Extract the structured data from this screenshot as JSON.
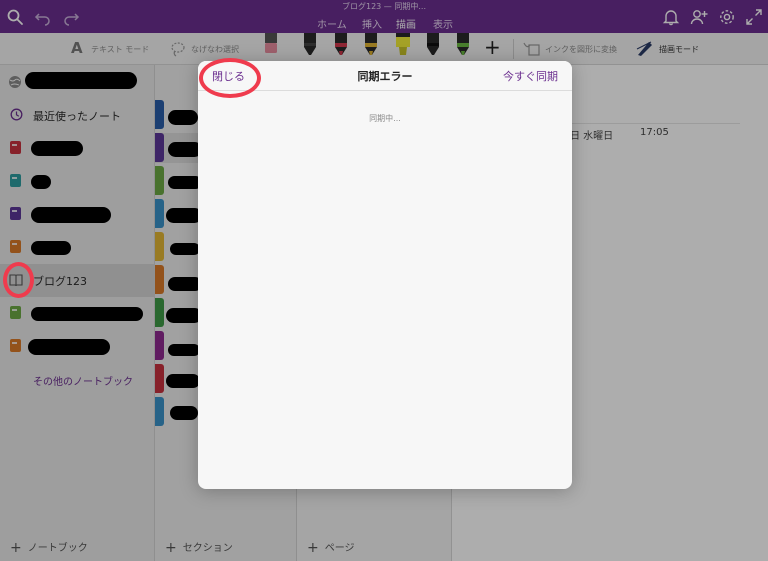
{
  "window": {
    "document_title": "ブログ123 — 同期中..."
  },
  "tabs": [
    {
      "label": "ホーム",
      "active": false
    },
    {
      "label": "挿入",
      "active": false
    },
    {
      "label": "描画",
      "active": true
    },
    {
      "label": "表示",
      "active": false
    }
  ],
  "ribbon": {
    "text_mode": "テキスト モード",
    "lasso_select": "なげなわ選択",
    "ink_to_shape": "インクを図形に変換",
    "draw_mode": "描画モード"
  },
  "notebooks": {
    "recent_label": "最近使ったノート",
    "selected_label": "ブログ123",
    "more_label": "その他のノートブック",
    "add_label": "ノートブック"
  },
  "sections": {
    "add_label": "セクション"
  },
  "pages": {
    "add_label": "ページ"
  },
  "canvas": {
    "date_fragment": "日 水曜日",
    "time": "17:05"
  },
  "modal": {
    "close_label": "閉じる",
    "title": "同期エラー",
    "sync_now_label": "今すぐ同期",
    "status_text": "同期中..."
  },
  "colors": {
    "brand_purple": "#6b2f8f",
    "annotation_red": "#ef3b4d"
  }
}
